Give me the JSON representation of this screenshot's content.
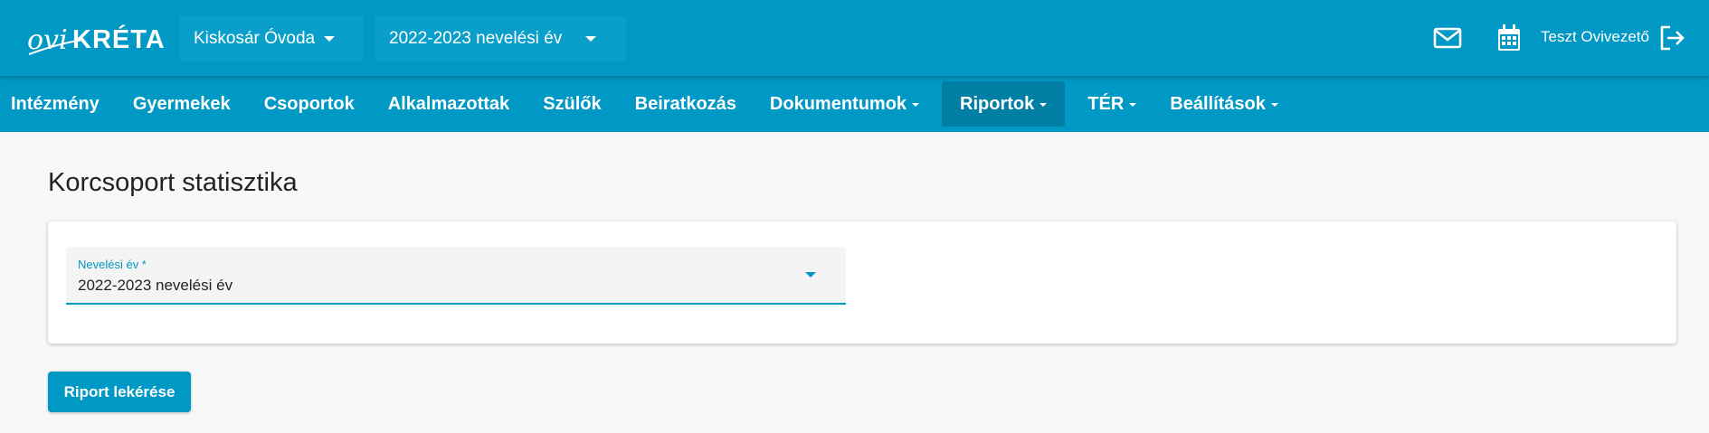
{
  "brand": {
    "logo_text": "oviKRÉTA"
  },
  "header": {
    "institution_select": "Kiskosár Óvoda",
    "year_select": "2022-2023 nevelési év",
    "user_name": "Teszt Ovivezető",
    "icons": [
      "mail-icon",
      "calendar-icon",
      "logout-icon"
    ]
  },
  "nav": {
    "items": [
      {
        "label": "Intézmény",
        "dropdown": false,
        "active": false
      },
      {
        "label": "Gyermekek",
        "dropdown": false,
        "active": false
      },
      {
        "label": "Csoportok",
        "dropdown": false,
        "active": false
      },
      {
        "label": "Alkalmazottak",
        "dropdown": false,
        "active": false
      },
      {
        "label": "Szülők",
        "dropdown": false,
        "active": false
      },
      {
        "label": "Beiratkozás",
        "dropdown": false,
        "active": false
      },
      {
        "label": "Dokumentumok",
        "dropdown": true,
        "active": false
      },
      {
        "label": "Riportok",
        "dropdown": true,
        "active": true
      },
      {
        "label": "TÉR",
        "dropdown": true,
        "active": false
      },
      {
        "label": "Beállítások",
        "dropdown": true,
        "active": false
      }
    ]
  },
  "main": {
    "title": "Korcsoport statisztika",
    "year_field": {
      "label": "Nevelési év *",
      "value": "2022-2023 nevelési év"
    },
    "submit_label": "Riport lekérése"
  },
  "colors": {
    "primary": "#0098c4",
    "active_nav": "#007ea3",
    "background": "#f8f8f8"
  }
}
